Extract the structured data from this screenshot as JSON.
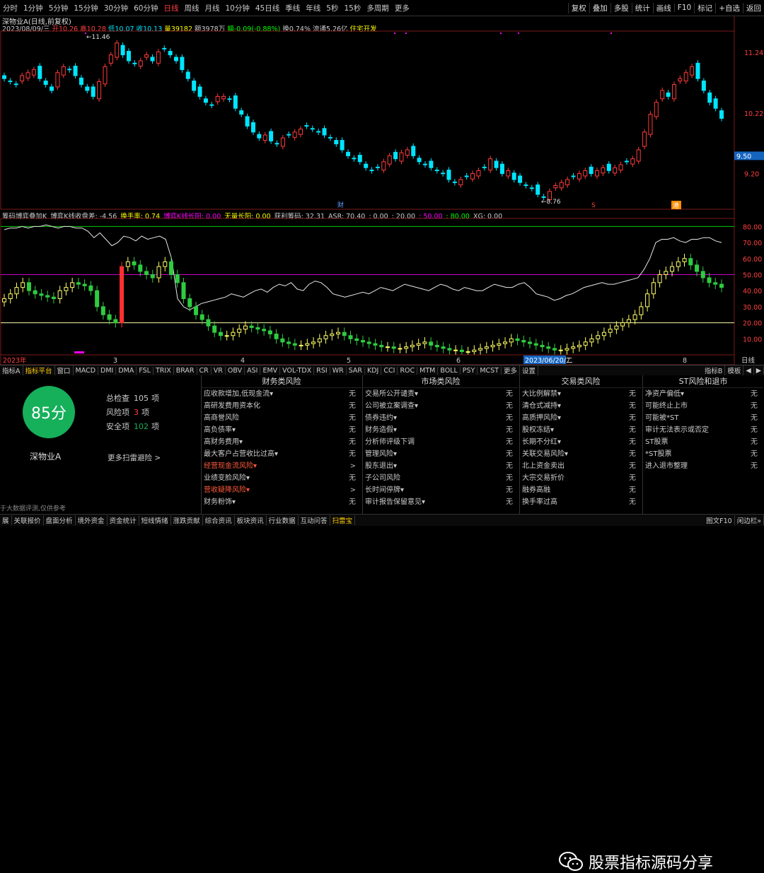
{
  "topbar": {
    "tabs": [
      "分时",
      "1分钟",
      "5分钟",
      "15分钟",
      "30分钟",
      "60分钟",
      "日线",
      "周线",
      "月线",
      "10分钟",
      "45日线",
      "季线",
      "年线",
      "5秒",
      "15秒",
      "多周期",
      "更多"
    ],
    "active_tab": "日线",
    "right_buttons": [
      "复权",
      "叠加",
      "多股",
      "统计",
      "画线",
      "F10",
      "标记",
      "+自选",
      "返回"
    ]
  },
  "info": {
    "title": "深物业A(日线,前复权)",
    "line2": [
      {
        "t": "2023/08/09/三",
        "c": "#cccccc"
      },
      {
        "t": "开10.26",
        "c": "#ff4040"
      },
      {
        "t": "高10.28",
        "c": "#ff4040"
      },
      {
        "t": "低10.07",
        "c": "#00e5ff"
      },
      {
        "t": "收10.13",
        "c": "#00e5ff"
      },
      {
        "t": "量39182",
        "c": "#ffff00"
      },
      {
        "t": "额3978万",
        "c": "#cccccc"
      },
      {
        "t": "幅-0.09(-0.88%)",
        "c": "#00ff00"
      },
      {
        "t": "换0.74%",
        "c": "#cccccc"
      },
      {
        "t": "流通5.26亿",
        "c": "#cccccc"
      },
      {
        "t": "住宅开发",
        "c": "#ffff00"
      }
    ],
    "ind_line": [
      {
        "t": "筹码博弈叠加K",
        "c": "#cccccc"
      },
      {
        "t": "博弈K线收盘差: -4.56",
        "c": "#cccccc"
      },
      {
        "t": "换手率: 0.74",
        "c": "#ffff00"
      },
      {
        "t": "博弈K线长阳: 0.00",
        "c": "#ff00ff"
      },
      {
        "t": "无量长阳: 0.00",
        "c": "#ffff00"
      },
      {
        "t": "获利筹码: 32.31",
        "c": "#cccccc"
      },
      {
        "t": "ASR: 70.40",
        "c": "#cccccc"
      },
      {
        "t": ": 0.00",
        "c": "#cccccc"
      },
      {
        "t": ": 20.00",
        "c": "#cccccc"
      },
      {
        "t": ": 50.00",
        "c": "#ff00ff"
      },
      {
        "t": ": 80.00",
        "c": "#00ff00"
      },
      {
        "t": "XG: 0.00",
        "c": "#cccccc"
      }
    ]
  },
  "price_axis": {
    "labels": [
      "11.24",
      "10.22",
      "9.50",
      "9.20"
    ],
    "current": "9.50",
    "high_label": "11.46",
    "low_label": "8.76"
  },
  "ind_axis": {
    "labels": [
      "80.00",
      "70.00",
      "60.00",
      "50.00",
      "40.00",
      "30.00",
      "20.00",
      "10.00"
    ]
  },
  "date_axis": {
    "labels": [
      "2023年",
      "3",
      "4",
      "5",
      "6",
      "7",
      "8"
    ],
    "cursor_date": "2023/06/20/二",
    "right_label": "日线"
  },
  "markers": {
    "cai": "财",
    "zeng": "增",
    "gang": "港",
    "s": "S"
  },
  "indicator_tabs": [
    "指标A",
    "指标平台",
    "窗口",
    "MACD",
    "DMI",
    "DMA",
    "FSL",
    "TRIX",
    "BRAR",
    "CR",
    "VR",
    "OBV",
    "ASI",
    "EMV",
    "VOL-TDX",
    "RSI",
    "WR",
    "SAR",
    "KDJ",
    "CCI",
    "ROC",
    "MTM",
    "BOLL",
    "PSY",
    "MCST",
    "更多",
    "设置"
  ],
  "indicator_tabs_active": "指标平台",
  "indicator_tabs_right": [
    "指标B",
    "模板",
    "◀",
    "▶"
  ],
  "scan": {
    "score": "85分",
    "company": "深物业A",
    "stats": [
      {
        "label": "总检查",
        "value": "105",
        "unit": "项",
        "color": "#cccccc"
      },
      {
        "label": "风险项",
        "value": "3",
        "unit": "项",
        "color": "#ff4040"
      },
      {
        "label": "安全项",
        "value": "102",
        "unit": "项",
        "color": "#16b05a"
      }
    ],
    "more_label": "更多扫雷避险 >",
    "footer": "于大数据评测,仅供参考",
    "columns": [
      {
        "title": "财务类风险",
        "rows": [
          {
            "name": "应收款增加,低现金流▾",
            "status": "无",
            "warn": false
          },
          {
            "name": "高研发费用资本化",
            "status": "无",
            "warn": false
          },
          {
            "name": "高商誉风险",
            "status": "无",
            "warn": false
          },
          {
            "name": "高负债率▾",
            "status": "无",
            "warn": false
          },
          {
            "name": "高财务费用▾",
            "status": "无",
            "warn": false
          },
          {
            "name": "最大客户占营收比过高▾",
            "status": "无",
            "warn": false
          },
          {
            "name": "经营现金流风险▾",
            "status": ">",
            "warn": true
          },
          {
            "name": "业绩变脸风险▾",
            "status": "无",
            "warn": false
          },
          {
            "name": "营收疑降风险▾",
            "status": ">",
            "warn": true
          },
          {
            "name": "财务粉饰▾",
            "status": "无",
            "warn": false
          }
        ]
      },
      {
        "title": "市场类风险",
        "rows": [
          {
            "name": "交易所公开谴责▾",
            "status": "无",
            "warn": false
          },
          {
            "name": "公司被立案调查▾",
            "status": "无",
            "warn": false
          },
          {
            "name": "债券违约▾",
            "status": "无",
            "warn": false
          },
          {
            "name": "财务造假▾",
            "status": "无",
            "warn": false
          },
          {
            "name": "分析师评级下调",
            "status": "无",
            "warn": false
          },
          {
            "name": "管理风险▾",
            "status": "无",
            "warn": false
          },
          {
            "name": "股东退出▾",
            "status": "无",
            "warn": false
          },
          {
            "name": "子公司风险",
            "status": "无",
            "warn": false
          },
          {
            "name": "长时间停牌▾",
            "status": "无",
            "warn": false
          },
          {
            "name": "审计报告保留意见▾",
            "status": "无",
            "warn": false
          }
        ]
      },
      {
        "title": "交易类风险",
        "rows": [
          {
            "name": "大比例解禁▾",
            "status": "无",
            "warn": false
          },
          {
            "name": "清仓式减持▾",
            "status": "无",
            "warn": false
          },
          {
            "name": "高质押风险▾",
            "status": "无",
            "warn": false
          },
          {
            "name": "股权冻结▾",
            "status": "无",
            "warn": false
          },
          {
            "name": "长期不分红▾",
            "status": "无",
            "warn": false
          },
          {
            "name": "关联交易风险▾",
            "status": "无",
            "warn": false
          },
          {
            "name": "北上资金卖出",
            "status": "无",
            "warn": false
          },
          {
            "name": "大宗交易折价",
            "status": "无",
            "warn": false
          },
          {
            "name": "融券高融",
            "status": "无",
            "warn": false
          },
          {
            "name": "换手率过高",
            "status": "无",
            "warn": false
          }
        ]
      },
      {
        "title": "ST风险和退市",
        "rows": [
          {
            "name": "净资产偏低▾",
            "status": "无",
            "warn": false
          },
          {
            "name": "可能终止上市",
            "status": "无",
            "warn": false
          },
          {
            "name": "可能被*ST",
            "status": "无",
            "warn": false
          },
          {
            "name": "审计无法表示或否定",
            "status": "无",
            "warn": false
          },
          {
            "name": "ST股票",
            "status": "无",
            "warn": false
          },
          {
            "name": "*ST股票",
            "status": "无",
            "warn": false
          },
          {
            "name": "进入退市整理",
            "status": "无",
            "warn": false
          }
        ]
      }
    ]
  },
  "bottombar": {
    "items": [
      "展",
      "关联报价",
      "盘面分析",
      "境外资金",
      "资金统计",
      "短线情绪",
      "涨跌贡献",
      "综合资讯",
      "板块资讯",
      "行业数据",
      "互动问答",
      "扫雷宝"
    ],
    "active": "扫雷宝",
    "right": [
      "图文F10",
      "闲边栏»"
    ]
  },
  "watermark": {
    "text": "股票指标源码分享"
  },
  "colors": {
    "up": "#ff3b3b",
    "down": "#00e5ff",
    "ind_up": "#ffff66",
    "ind_down": "#2ecc40",
    "line80": "#00cc00",
    "line50": "#cc00cc",
    "line20": "#ffffaa"
  },
  "chart_data": [
    {
      "type": "candlestick",
      "x_range": [
        "2023-01",
        "2023-08-09"
      ],
      "ylim": [
        8.6,
        11.6
      ],
      "series": [
        {
          "name": "",
          "values": [
            10.8,
            10.75,
            10.7,
            10.85,
            10.9,
            10.95,
            10.8,
            10.7,
            10.6,
            10.9,
            11.0,
            10.95,
            10.85,
            10.7,
            10.6,
            10.5,
            10.75,
            11.0,
            11.2,
            11.4,
            11.2,
            11.1,
            11.05,
            11.1,
            11.2,
            11.1,
            11.25,
            11.3,
            11.2,
            11.1,
            10.95,
            10.8,
            10.6,
            10.5,
            10.4,
            10.35,
            10.5,
            10.5,
            10.45,
            10.3,
            10.2,
            10.0,
            9.9,
            9.8,
            9.85,
            9.75,
            9.7,
            9.8,
            9.85,
            9.9,
            9.95,
            10.0,
            9.95,
            9.9,
            9.85,
            9.8,
            9.7,
            9.6,
            9.5,
            9.45,
            9.4,
            9.3,
            9.25,
            9.3,
            9.4,
            9.5,
            9.45,
            9.55,
            9.6,
            9.5,
            9.4,
            9.35,
            9.3,
            9.25,
            9.2,
            9.1,
            9.05,
            9.1,
            9.15,
            9.2,
            9.25,
            9.3,
            9.45,
            9.3,
            9.2,
            9.25,
            9.1,
            9.05,
            9.0,
            8.95,
            8.85,
            8.8,
            8.9,
            9.0,
            9.05,
            9.1,
            9.15,
            9.2,
            9.25,
            9.2,
            9.25,
            9.3,
            9.25,
            9.3,
            9.35,
            9.4,
            9.45,
            9.6,
            9.9,
            10.2,
            10.4,
            10.6,
            10.5,
            10.7,
            10.8,
            10.9,
            11.0,
            10.8,
            10.6,
            10.4,
            10.3,
            10.13
          ]
        }
      ]
    },
    {
      "type": "line",
      "ylim": [
        0,
        85
      ],
      "series": [
        {
          "name": "",
          "values": [
            78,
            79,
            79,
            80,
            79,
            80,
            80,
            81,
            80,
            79,
            80,
            80,
            79,
            79,
            77,
            73,
            76,
            72,
            68,
            70,
            74,
            73,
            71,
            74,
            72,
            73,
            74,
            72,
            60,
            35,
            30,
            28,
            30,
            32,
            33,
            34,
            35,
            36,
            38,
            37,
            36,
            38,
            40,
            41,
            39,
            42,
            44,
            43,
            45,
            41,
            40,
            44,
            46,
            45,
            42,
            38,
            37,
            36,
            37,
            38,
            39,
            38,
            40,
            42,
            41,
            40,
            42,
            44,
            43,
            42,
            41,
            40,
            42,
            44,
            43,
            41,
            40,
            42,
            41,
            40,
            40,
            42,
            44,
            43,
            42,
            42,
            44,
            45,
            42,
            38,
            37,
            36,
            34,
            35,
            37,
            38,
            40,
            42,
            43,
            44,
            45,
            44,
            44,
            45,
            46,
            47,
            48,
            53,
            60,
            70,
            72,
            72,
            73,
            71,
            70,
            72,
            72,
            73,
            73,
            71,
            70
          ]
        }
      ]
    },
    {
      "type": "candlestick",
      "ylim": [
        0,
        85
      ],
      "series": [
        {
          "name": "",
          "values": [
            35,
            38,
            42,
            45,
            40,
            38,
            37,
            36,
            35,
            40,
            42,
            45,
            44,
            43,
            40,
            30,
            25,
            22,
            20,
            55,
            58,
            56,
            52,
            50,
            48,
            55,
            58,
            50,
            45,
            35,
            30,
            25,
            22,
            18,
            14,
            12,
            12,
            14,
            16,
            18,
            17,
            16,
            15,
            13,
            10,
            8,
            7,
            6,
            6,
            7,
            8,
            10,
            12,
            13,
            14,
            12,
            10,
            9,
            8,
            7,
            6,
            5,
            5,
            4,
            4,
            5,
            6,
            7,
            8,
            6,
            5,
            4,
            3,
            3,
            2,
            2,
            3,
            4,
            5,
            6,
            7,
            8,
            10,
            9,
            8,
            7,
            6,
            5,
            4,
            3,
            3,
            4,
            5,
            6,
            8,
            10,
            12,
            14,
            16,
            18,
            20,
            22,
            25,
            30,
            38,
            45,
            50,
            52,
            55,
            58,
            60,
            56,
            52,
            48,
            45,
            44,
            42
          ]
        }
      ]
    }
  ]
}
